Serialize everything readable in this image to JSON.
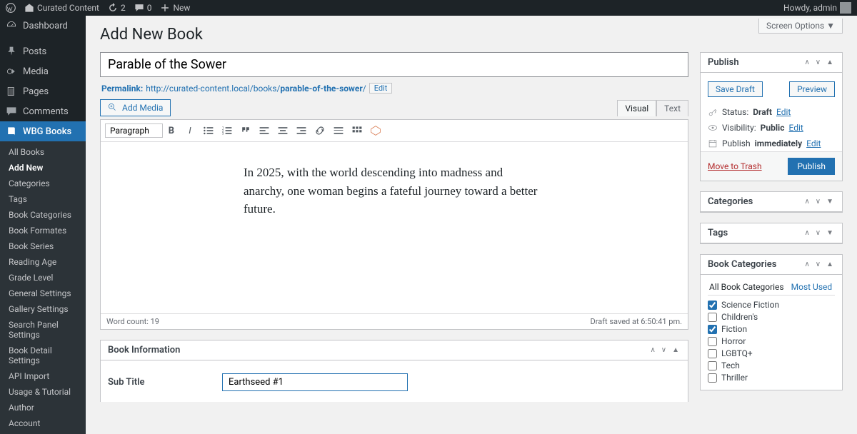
{
  "adminbar": {
    "site_name": "Curated Content",
    "updates_count": "2",
    "comments_count": "0",
    "new_label": "New",
    "greeting": "Howdy, admin"
  },
  "screen_options_label": "Screen Options ▼",
  "page_title": "Add New Book",
  "sidebar": {
    "items": [
      {
        "label": "Dashboard",
        "icon": "dashboard"
      },
      {
        "label": "Posts",
        "icon": "pin"
      },
      {
        "label": "Media",
        "icon": "media"
      },
      {
        "label": "Pages",
        "icon": "page"
      },
      {
        "label": "Comments",
        "icon": "comment"
      },
      {
        "label": "WBG Books",
        "icon": "book",
        "current": true
      }
    ],
    "submenu": [
      {
        "label": "All Books"
      },
      {
        "label": "Add New",
        "current": true
      },
      {
        "label": "Categories"
      },
      {
        "label": "Tags"
      },
      {
        "label": "Book Categories"
      },
      {
        "label": "Book Formates"
      },
      {
        "label": "Book Series"
      },
      {
        "label": "Reading Age"
      },
      {
        "label": "Grade Level"
      },
      {
        "label": "General Settings"
      },
      {
        "label": "Gallery Settings"
      },
      {
        "label": "Search Panel Settings"
      },
      {
        "label": "Book Detail Settings"
      },
      {
        "label": "API Import"
      },
      {
        "label": "Usage & Tutorial"
      },
      {
        "label": "Author"
      },
      {
        "label": "Account"
      }
    ]
  },
  "title_value": "Parable of the Sower",
  "permalink": {
    "label": "Permalink:",
    "base": "http://curated-content.local/books/",
    "slug": "parable-of-the-sower",
    "slash": "/",
    "edit": "Edit"
  },
  "editor": {
    "add_media": "Add Media",
    "tabs": {
      "visual": "Visual",
      "text": "Text"
    },
    "paragraph": "Paragraph",
    "content": "In 2025, with the world descending into madness and anarchy, one woman begins a fateful journey toward a better future.",
    "word_count_label": "Word count: ",
    "word_count": "19",
    "draft_saved": "Draft saved at 6:50:41 pm."
  },
  "publish": {
    "heading": "Publish",
    "save_draft": "Save Draft",
    "preview": "Preview",
    "status_label": "Status:",
    "status_value": "Draft",
    "visibility_label": "Visibility:",
    "visibility_value": "Public",
    "publish_label": "Publish",
    "publish_value": "immediately",
    "edit": "Edit",
    "trash": "Move to Trash",
    "button": "Publish"
  },
  "side_boxes": {
    "categories": "Categories",
    "tags": "Tags",
    "book_categories": "Book Categories"
  },
  "book_cats": {
    "tabs": {
      "all": "All Book Categories",
      "most": "Most Used"
    },
    "items": [
      {
        "label": "Science Fiction",
        "checked": true
      },
      {
        "label": "Children's",
        "checked": false
      },
      {
        "label": "Fiction",
        "checked": true
      },
      {
        "label": "Horror",
        "checked": false
      },
      {
        "label": "LGBTQ+",
        "checked": false
      },
      {
        "label": "Tech",
        "checked": false
      },
      {
        "label": "Thriller",
        "checked": false
      }
    ]
  },
  "book_info": {
    "heading": "Book Information",
    "subtitle_label": "Sub Title",
    "subtitle_value": "Earthseed #1"
  }
}
